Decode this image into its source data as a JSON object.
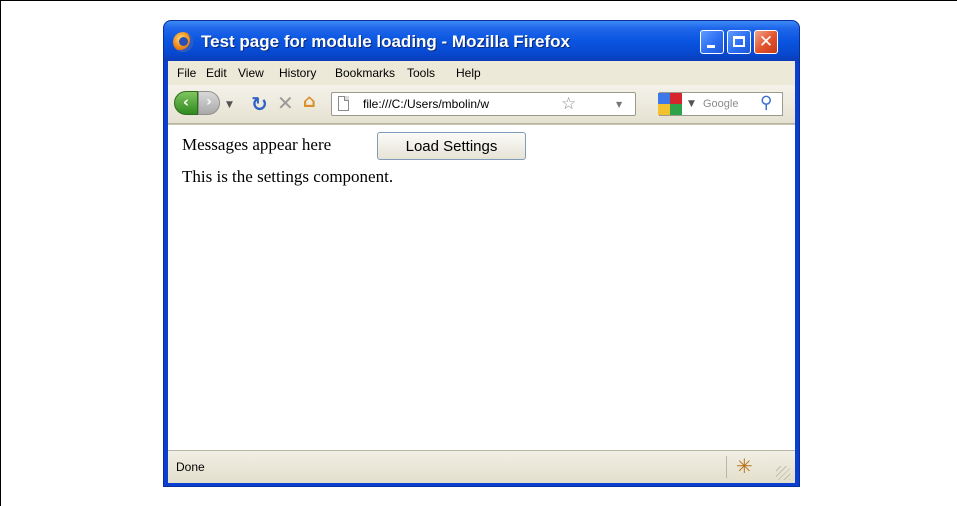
{
  "window": {
    "title": "Test page for module loading - Mozilla Firefox",
    "close_glyph": "✕"
  },
  "menu": {
    "items": [
      "File",
      "Edit",
      "View",
      "History",
      "Bookmarks",
      "Tools",
      "Help"
    ]
  },
  "navbar": {
    "back_glyph": "‹",
    "forward_glyph": "›",
    "reload_glyph": "↻",
    "stop_glyph": "✕",
    "home_glyph": "⌂",
    "url": "file:///C:/Users/mbolin/w",
    "bookmark_star_glyph": "☆",
    "search_placeholder": "Google",
    "search_glyph": "⚲"
  },
  "page": {
    "messages_text": "Messages appear here",
    "load_button_label": "Load Settings",
    "settings_text": "This is the settings component."
  },
  "status": {
    "text": "Done",
    "bug_glyph": "✳"
  },
  "icons": [
    "firefox-logo-icon",
    "minimize-icon",
    "maximize-icon",
    "close-icon",
    "back-icon",
    "forward-icon",
    "history-dropdown-icon",
    "reload-icon",
    "stop-icon",
    "home-icon",
    "page-icon",
    "bookmark-star-icon",
    "url-dropdown-icon",
    "search-engine-icon",
    "search-icon",
    "firebug-icon",
    "resize-grip-icon"
  ],
  "colors": {
    "titlebar_blue": "#0a55e0",
    "chrome_beige": "#ece9d8",
    "close_red": "#e2512b",
    "back_green": "#2f8a1f"
  }
}
